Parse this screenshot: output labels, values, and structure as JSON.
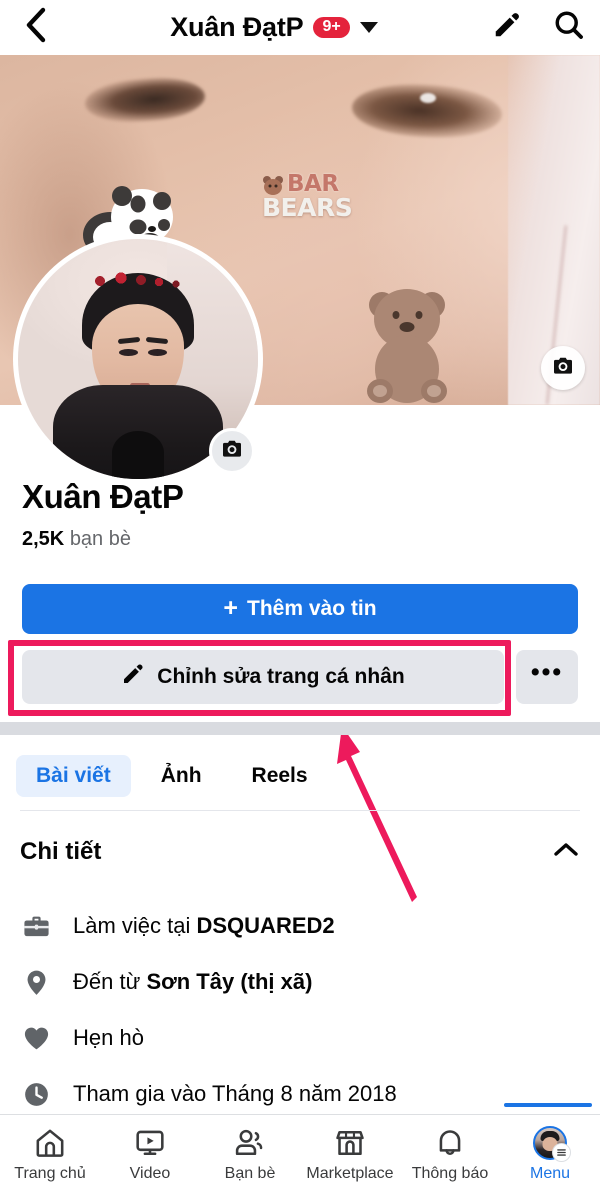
{
  "topbar": {
    "back_icon": "chevron-left-icon",
    "title": "Xuân ĐạtP",
    "badge": "9+",
    "caret_icon": "caret-down-icon",
    "edit_icon": "pencil-icon",
    "search_icon": "search-icon"
  },
  "cover": {
    "sticker_logo_line1": "BAR",
    "sticker_logo_line2": "BEARS",
    "camera_icon": "camera-icon"
  },
  "avatar": {
    "camera_icon": "camera-icon"
  },
  "profile": {
    "name": "Xuân ĐạtP",
    "friends_count": "2,5K",
    "friends_label": "bạn bè"
  },
  "actions": {
    "add_story_label": "Thêm vào tin",
    "add_story_plus": "+",
    "edit_profile_label": "Chỉnh sửa trang cá nhân",
    "edit_profile_icon": "pencil-icon",
    "more_label": "•••"
  },
  "annotation": {
    "box_color": "#ED1A5C",
    "arrow_color": "#ED1A5C"
  },
  "tabs": [
    {
      "label": "Bài viết",
      "active": true
    },
    {
      "label": "Ảnh",
      "active": false
    },
    {
      "label": "Reels",
      "active": false
    }
  ],
  "details": {
    "title": "Chi tiết",
    "collapse_icon": "chevron-up-icon",
    "rows": [
      {
        "icon": "briefcase-icon",
        "prefix": "Làm việc tại ",
        "strong": "DSQUARED2",
        "suffix": ""
      },
      {
        "icon": "location-pin-icon",
        "prefix": "Đến từ ",
        "strong": "Sơn Tây (thị xã)",
        "suffix": ""
      },
      {
        "icon": "heart-icon",
        "prefix": "Hẹn hò",
        "strong": "",
        "suffix": ""
      },
      {
        "icon": "clock-icon",
        "prefix": "Tham gia vào Tháng 8 năm 2018",
        "strong": "",
        "suffix": ""
      }
    ]
  },
  "bottomnav": [
    {
      "label": "Trang chủ",
      "icon": "home-icon",
      "active": false
    },
    {
      "label": "Video",
      "icon": "video-icon",
      "active": false
    },
    {
      "label": "Bạn bè",
      "icon": "friends-icon",
      "active": false
    },
    {
      "label": "Marketplace",
      "icon": "marketplace-icon",
      "active": false
    },
    {
      "label": "Thông báo",
      "icon": "bell-icon",
      "active": false
    },
    {
      "label": "Menu",
      "icon": "avatar-menu-icon",
      "active": true
    }
  ],
  "colors": {
    "facebook_blue": "#1B74E4",
    "button_grey": "#E4E6EB",
    "badge_red": "#E4233C",
    "annotation_pink": "#ED1A5C",
    "tab_active_bg": "#E7F0FD"
  }
}
